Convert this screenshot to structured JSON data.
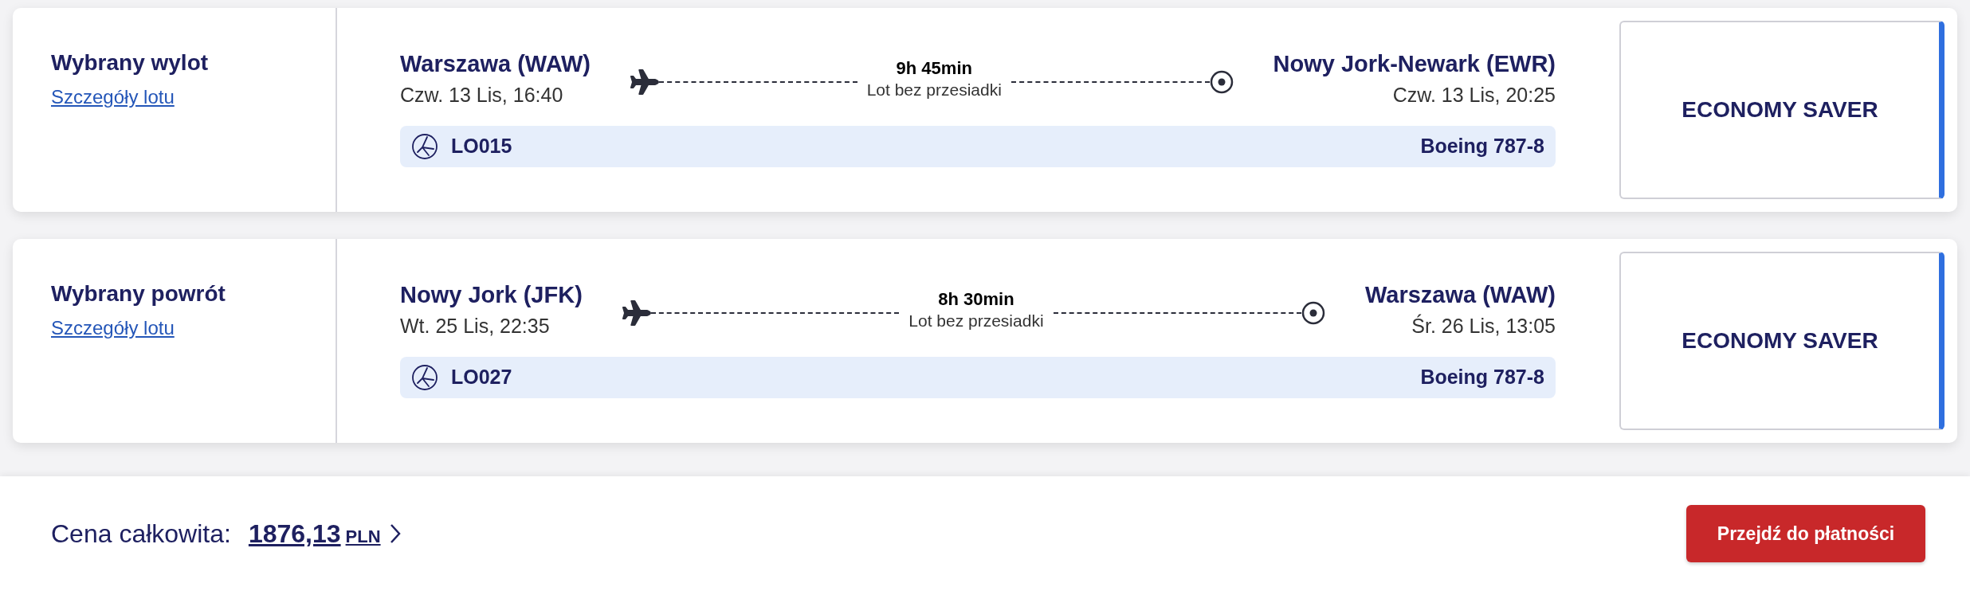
{
  "flights": [
    {
      "heading": "Wybrany wylot",
      "details_link": "Szczegóły lotu",
      "origin": {
        "city": "Warszawa (WAW)",
        "datetime": "Czw. 13 Lis, 16:40"
      },
      "duration": "9h 45min",
      "stops": "Lot bez przesiadki",
      "destination": {
        "city": "Nowy Jork-Newark (EWR)",
        "datetime": "Czw. 13 Lis, 20:25"
      },
      "flight_number": "LO015",
      "aircraft": "Boeing 787-8",
      "fare": {
        "label": "ECONOMY SAVER",
        "selected": true
      }
    },
    {
      "heading": "Wybrany powrót",
      "details_link": "Szczegóły lotu",
      "origin": {
        "city": "Nowy Jork (JFK)",
        "datetime": "Wt. 25 Lis, 22:35"
      },
      "duration": "8h 30min",
      "stops": "Lot bez przesiadki",
      "destination": {
        "city": "Warszawa (WAW)",
        "datetime": "Śr. 26 Lis, 13:05"
      },
      "flight_number": "LO027",
      "aircraft": "Boeing 787-8",
      "fare": {
        "label": "ECONOMY SAVER",
        "selected": true
      }
    }
  ],
  "footer": {
    "total_label": "Cena całkowita:",
    "amount": "1876,13",
    "currency": "PLN",
    "pay_button": "Przejdź do płatności"
  }
}
